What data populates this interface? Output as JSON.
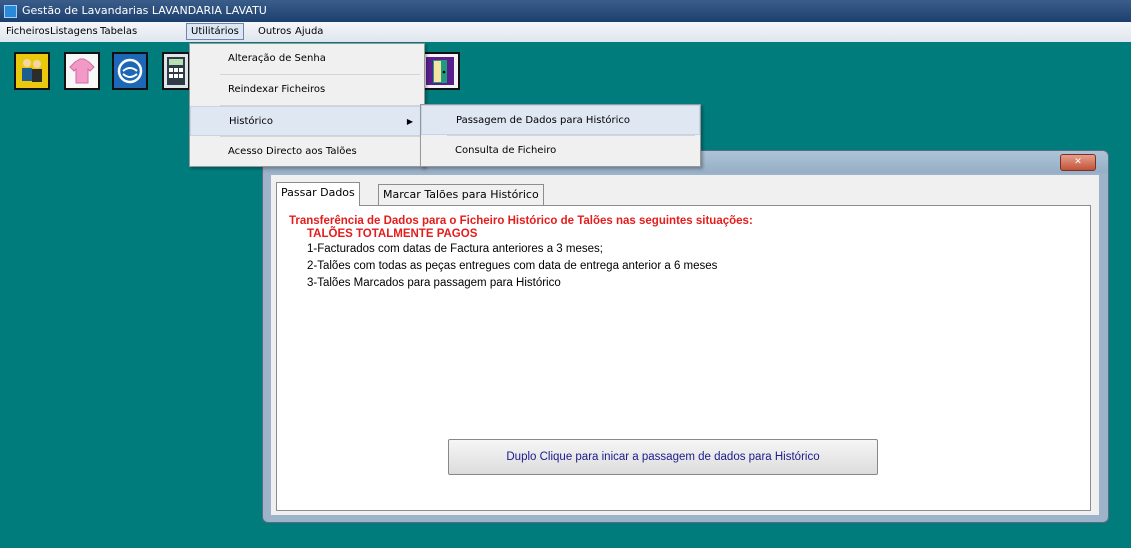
{
  "window": {
    "title": "Gestão de Lavandarias   LAVANDARIA LAVATU"
  },
  "menubar": {
    "items": [
      "Ficheiros",
      "Listagens",
      "Tabelas",
      "Utilitários",
      "Outros",
      "Ajuda"
    ],
    "active": "Utilitários"
  },
  "toolbar": {
    "icons": [
      "people-icon",
      "shirt-icon",
      "laundry-machine-icon",
      "calculator-icon",
      "exit-door-icon"
    ]
  },
  "dropdown": {
    "items": [
      "Alteração de Senha",
      "Reindexar Ficheiros",
      "Histórico",
      "Acesso Directo aos Talões"
    ],
    "highlighted": "Histórico"
  },
  "submenu": {
    "items": [
      "Passagem de Dados para Histórico",
      "Consulta de Ficheiro"
    ],
    "highlighted": "Passagem de Dados para Histórico"
  },
  "dialog": {
    "tabs": [
      "Passar Dados",
      "Marcar Talões para Histórico"
    ],
    "active_tab": "Passar Dados",
    "heading": "Transferência de Dados para o Ficheiro Histórico de Talões nas seguintes situações:",
    "subheading": "TALÕES TOTALMENTE PAGOS",
    "conditions": [
      "1-Facturados com datas de Factura anteriores a 3 meses;",
      "2-Talões com todas as peças entregues com data de entrega anterior a 6 meses",
      "3-Talões Marcados para passagem para  Histórico"
    ],
    "action_button": "Duplo Clique para inicar a passagem de dados para Histórico",
    "close_symbol": "✕"
  },
  "colors": {
    "desktop": "#017c7d",
    "heading_red": "#e51c1c",
    "button_text": "#1a1a8c"
  }
}
